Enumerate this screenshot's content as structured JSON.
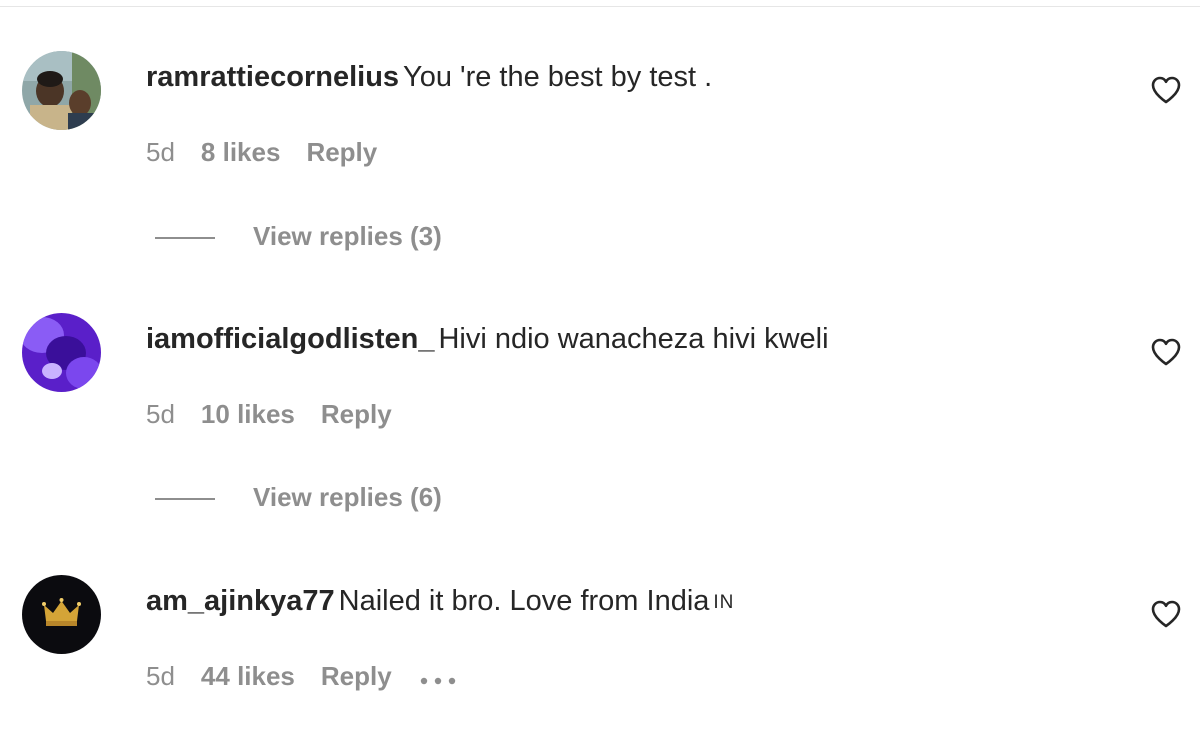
{
  "comments": [
    {
      "username": "ramrattiecornelius",
      "text": "You 're the best by test .",
      "flag": "",
      "age": "5d",
      "likes": "8 likes",
      "reply": "Reply",
      "view_replies": "View replies (3)",
      "avatar_icon": "user-photo-avatar"
    },
    {
      "username": "iamofficialgodlisten_",
      "text": "Hivi ndio wanacheza hivi kweli",
      "flag": "",
      "age": "5d",
      "likes": "10 likes",
      "reply": "Reply",
      "view_replies": "View replies (6)",
      "avatar_icon": "purple-photo-avatar"
    },
    {
      "username": "am_ajinkya77",
      "text": "Nailed it bro. Love from India",
      "flag": "IN",
      "age": "5d",
      "likes": "44 likes",
      "reply": "Reply",
      "view_replies": "",
      "avatar_icon": "crown-avatar"
    }
  ],
  "colors": {
    "primary_text": "#262626",
    "secondary_text": "#8e8e8e",
    "divider": "#e6e6e6"
  },
  "icons": {
    "like": "heart-outline-icon",
    "more": "more-options-icon"
  }
}
